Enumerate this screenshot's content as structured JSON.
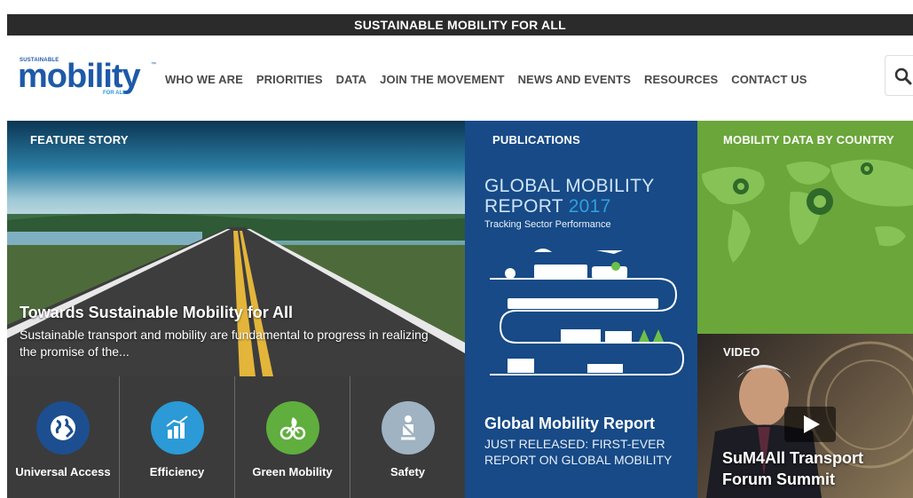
{
  "topbar": {
    "title": "SUSTAINABLE MOBILITY FOR ALL"
  },
  "logo": {
    "small_top": "SUSTAINABLE",
    "wordmark": "mobility",
    "small_bottom": "FOR ALL",
    "trademark": "™"
  },
  "nav": {
    "items": [
      {
        "label": "WHO WE ARE"
      },
      {
        "label": "PRIORITIES"
      },
      {
        "label": "DATA"
      },
      {
        "label": "JOIN THE MOVEMENT"
      },
      {
        "label": "NEWS AND EVENTS"
      },
      {
        "label": "RESOURCES"
      },
      {
        "label": "CONTACT US"
      }
    ]
  },
  "search": {
    "icon": "search-icon"
  },
  "feature": {
    "label": "FEATURE STORY",
    "headline": "Towards Sustainable Mobility for All",
    "description": "Sustainable transport and mobility are fundamental to progress in realizing the promise of the..."
  },
  "publications": {
    "label": "PUBLICATIONS",
    "report_title_line1": "GLOBAL MOBILITY",
    "report_title_line2": "REPORT",
    "report_year": "2017",
    "report_subtitle": "Tracking Sector Performance",
    "headline": "Global Mobility Report",
    "description": "JUST RELEASED: FIRST-EVER REPORT ON GLOBAL MOBILITY"
  },
  "data_tile": {
    "label": "MOBILITY DATA BY COUNTRY"
  },
  "video": {
    "label": "VIDEO",
    "title_line1": "SuM4All Transport",
    "title_line2": "Forum Summit"
  },
  "priorities": [
    {
      "label": "Universal Access",
      "color": "#1d4e8f",
      "icon": "globe-icon"
    },
    {
      "label": "Efficiency",
      "color": "#2b9ad6",
      "icon": "bar-chart-icon"
    },
    {
      "label": "Green Mobility",
      "color": "#5fae3e",
      "icon": "bicycle-leaf-icon"
    },
    {
      "label": "Safety",
      "color": "#9fb3c2",
      "icon": "seatbelt-icon"
    }
  ],
  "colors": {
    "topbar": "#2b2b2b",
    "brand_blue": "#1d5aa8",
    "nav_text": "#4a4a4a",
    "pub_bg": "#174a86",
    "data_bg": "#6aa63a"
  }
}
